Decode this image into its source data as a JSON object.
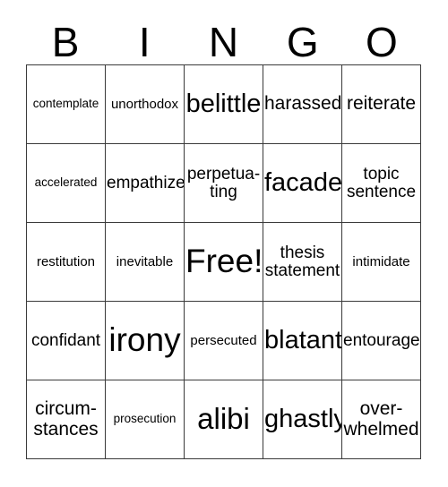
{
  "card": {
    "header": {
      "letters": [
        "B",
        "I",
        "N",
        "G",
        "O"
      ]
    },
    "rows": [
      [
        {
          "text": "contemplate",
          "size": "s-xs"
        },
        {
          "text": "unorthodox",
          "size": "s-sm"
        },
        {
          "text": "belittle",
          "size": "s-xxl"
        },
        {
          "text": "harassed",
          "size": "s-lg"
        },
        {
          "text": "reiterate",
          "size": "s-lg"
        }
      ],
      [
        {
          "text": "accelerated",
          "size": "s-xs"
        },
        {
          "text": "empathize",
          "size": "s-md"
        },
        {
          "text": "perpetua-\nting",
          "size": "s-md"
        },
        {
          "text": "facade",
          "size": "s-xxl"
        },
        {
          "text": "topic\nsentence",
          "size": "s-md"
        }
      ],
      [
        {
          "text": "restitution",
          "size": "s-sm"
        },
        {
          "text": "inevitable",
          "size": "s-sm"
        },
        {
          "text": "Free!",
          "size": "s-mega"
        },
        {
          "text": "thesis\nstatement",
          "size": "s-md"
        },
        {
          "text": "intimidate",
          "size": "s-sm"
        }
      ],
      [
        {
          "text": "confidant",
          "size": "s-md"
        },
        {
          "text": "irony",
          "size": "s-mega"
        },
        {
          "text": "persecuted",
          "size": "s-sm"
        },
        {
          "text": "blatant",
          "size": "s-xxl"
        },
        {
          "text": "entourage",
          "size": "s-md"
        }
      ],
      [
        {
          "text": "circum-\nstances",
          "size": "s-lg"
        },
        {
          "text": "prosecution",
          "size": "s-xs"
        },
        {
          "text": "alibi",
          "size": "s-huge"
        },
        {
          "text": "ghastly",
          "size": "s-xxl"
        },
        {
          "text": "over-\nwhelmed",
          "size": "s-lg"
        }
      ]
    ]
  },
  "colors": {
    "background": "#ffffff",
    "text": "#000000",
    "grid_line": "#3a3a3a"
  }
}
